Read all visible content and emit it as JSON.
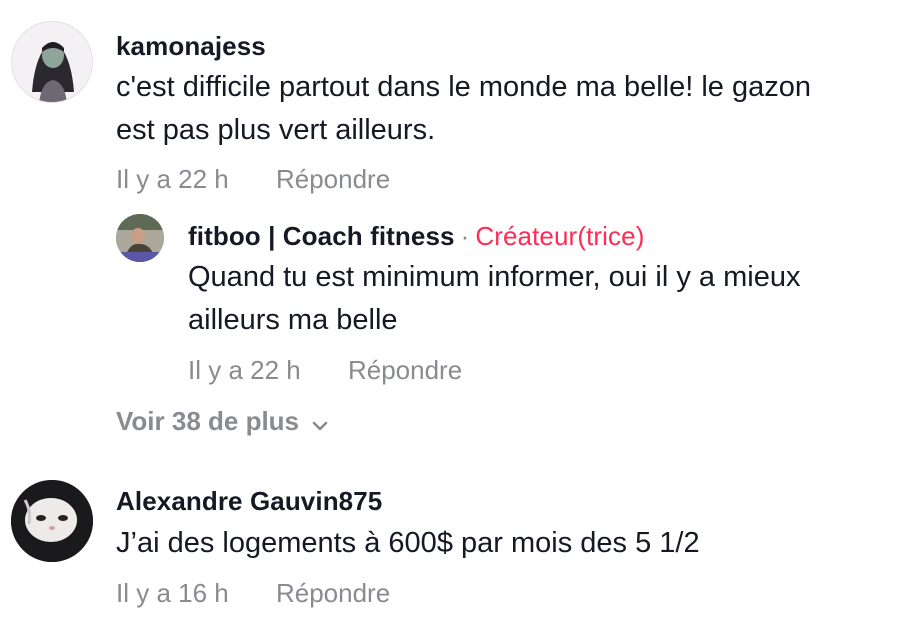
{
  "comments": [
    {
      "username": "kamonajess",
      "text": "c'est difficile partout dans le monde ma belle! le gazon est pas plus vert ailleurs.",
      "time": "Il y a 22 h",
      "reply": "Répondre",
      "avatar_icon": "user-avatar-illustration"
    },
    {
      "username": "fitboo | Coach fitness",
      "separator": "·",
      "badge": "Créateur(trice)",
      "badge_color": "#fe2c55",
      "text": "Quand tu est minimum informer, oui il y a mieux ailleurs ma belle",
      "time": "Il y a 22 h",
      "reply": "Répondre",
      "avatar_icon": "user-avatar-photo"
    },
    {
      "username": "Alexandre Gauvin875",
      "text": "J’ai des logements à 600$ par mois des 5 1/2",
      "time": "Il y a 16 h",
      "reply": "Répondre",
      "avatar_icon": "user-avatar-photo"
    }
  ],
  "view_more": {
    "label": "Voir 38 de plus",
    "icon": "chevron-down-icon"
  },
  "colors": {
    "primary_text": "#161823",
    "secondary_text": "#8a8b91",
    "accent": "#fe2c55"
  }
}
